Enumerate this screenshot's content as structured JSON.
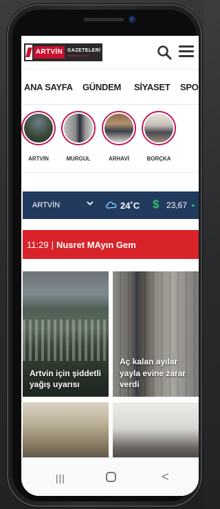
{
  "header": {
    "logo_brand": "ARTVİN",
    "logo_gazeteleri": "GAZETELERİ",
    "logo_tagline": "Tarafsız ve Doğru"
  },
  "nav": {
    "items": [
      "ANA SAYFA",
      "GÜNDEM",
      "SİYASET",
      "SPOR"
    ]
  },
  "stories": [
    {
      "label": "ARTVİN"
    },
    {
      "label": "MURGUL"
    },
    {
      "label": "ARHAVİ"
    },
    {
      "label": "BORÇKA"
    }
  ],
  "weather": {
    "city": "ARTVİN",
    "temperature": "24˚C",
    "currency_symbol": "$",
    "exchange_rate": "23,67"
  },
  "breaking": {
    "time": "11:29",
    "separator": "|",
    "headline": "Nusret MAyın Gem"
  },
  "news": [
    {
      "title": "Artvin için şiddetli yağış uyarısı"
    },
    {
      "title": "Aç kalan ayılar yayla evine zarar verdi"
    },
    {
      "title": ""
    },
    {
      "title": ""
    }
  ],
  "navbar": {
    "recent_glyph": "|||",
    "back_glyph": "<"
  },
  "colors": {
    "brand_red": "#c8102e",
    "breaking_red": "#d8232a",
    "weather_bg": "#223a5e",
    "accent_green": "#2ec06a",
    "story_ring": "#c2185b"
  }
}
